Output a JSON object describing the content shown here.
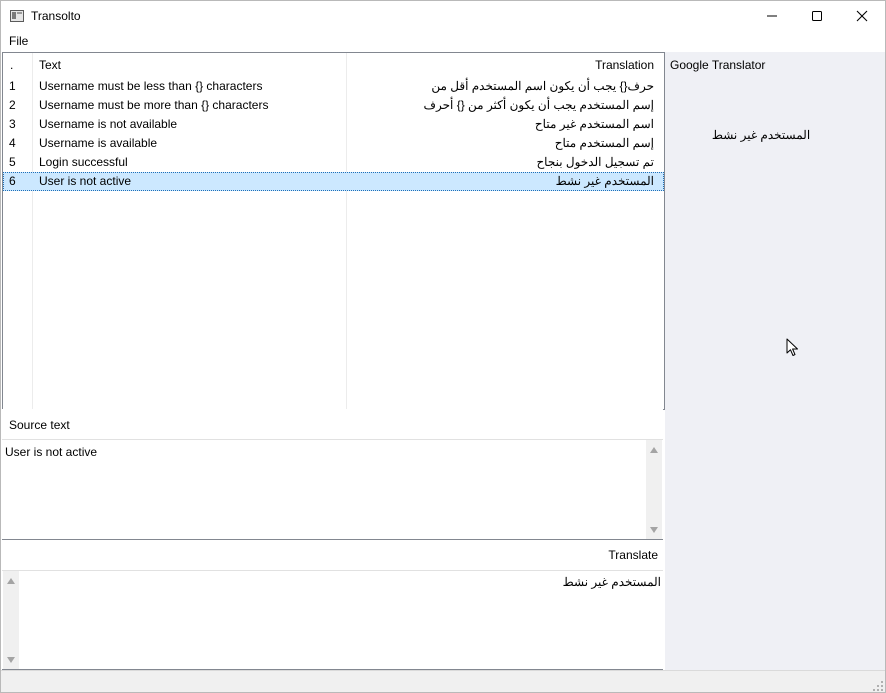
{
  "window": {
    "title": "Transolto"
  },
  "menu": {
    "file": "File"
  },
  "table": {
    "headers": {
      "index": ".",
      "text": "Text",
      "translation": "Translation"
    },
    "rows": [
      {
        "num": "1",
        "text": "Username must be less than {} characters",
        "translation": "حرف{} يجب أن يكون اسم المستخدم أقل من"
      },
      {
        "num": "2",
        "text": "Username must be more than {} characters",
        "translation": "إسم المستخدم يجب أن يكون أكثر من {} أحرف"
      },
      {
        "num": "3",
        "text": "Username is not available",
        "translation": "اسم المستخدم غير متاح"
      },
      {
        "num": "4",
        "text": "Username is available",
        "translation": "إسم المستخدم متاح"
      },
      {
        "num": "5",
        "text": "Login successful",
        "translation": "تم تسجيل الدخول بنجاح"
      },
      {
        "num": "6",
        "text": "User is not active",
        "translation": "المستخدم غير نشط"
      }
    ],
    "selected_row": "6"
  },
  "google": {
    "label": "Google Translator",
    "output": "المستخدم غير نشط"
  },
  "source": {
    "label": "Source text",
    "value": "User is not active"
  },
  "translate": {
    "label": "Translate",
    "value": "المستخدم غير نشط"
  },
  "icons": {
    "app": "app-icon",
    "minimize": "minimize-icon",
    "maximize": "maximize-icon",
    "close": "close-icon",
    "scroll_up": "scroll-up-arrow-icon",
    "scroll_down": "scroll-down-arrow-icon",
    "resize_grip": "resize-grip-icon",
    "cursor": "mouse-cursor-icon"
  },
  "colors": {
    "selection": "#cce8ff",
    "right_panel": "#eff0f5",
    "statusbar": "#f0f0f0"
  }
}
